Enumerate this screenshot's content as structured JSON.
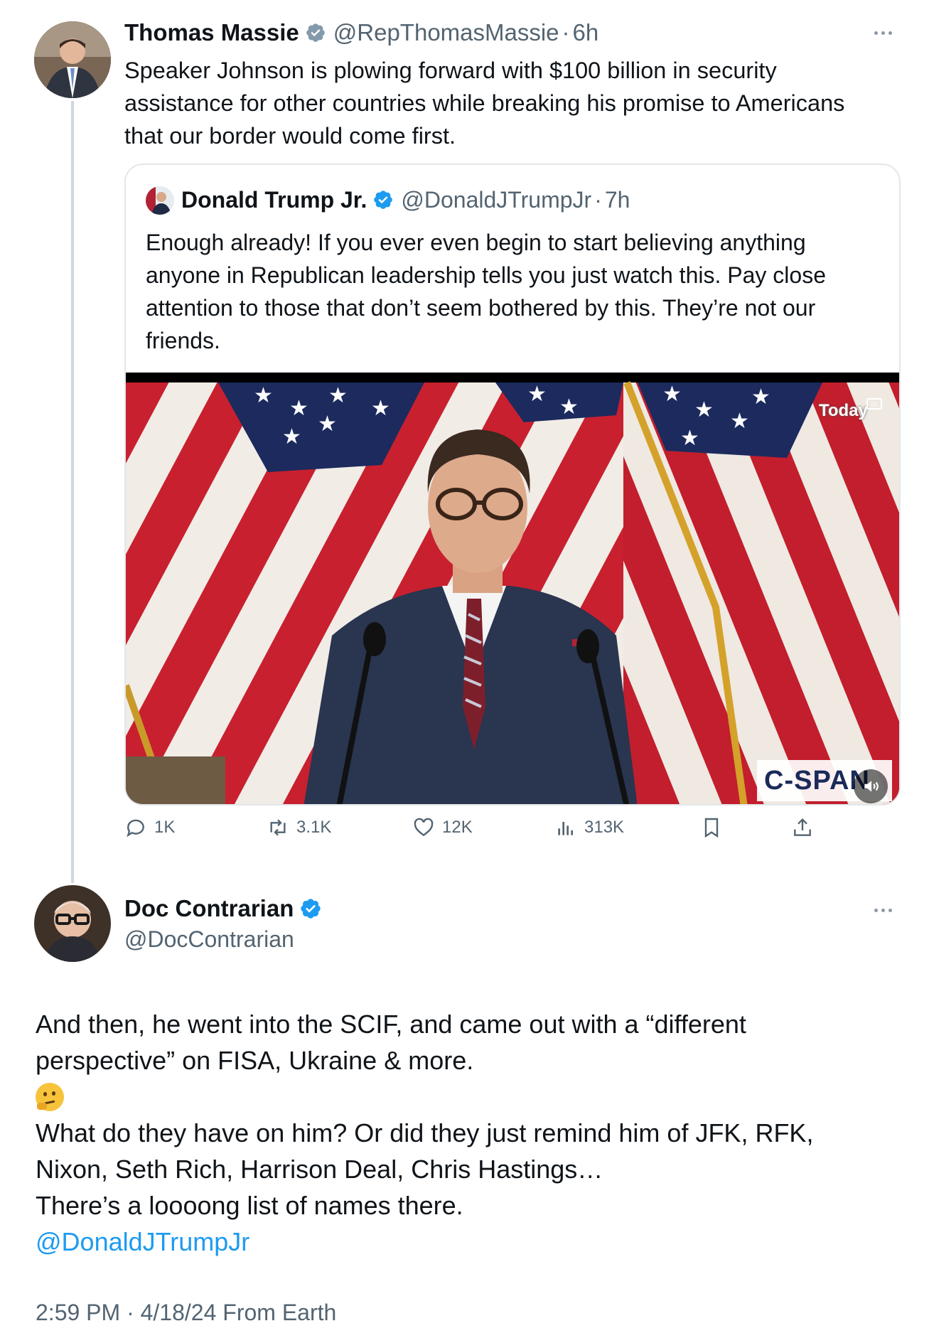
{
  "main_tweet": {
    "author": {
      "name": "Thomas Massie",
      "handle": "@RepThomasMassie",
      "time": "6h"
    },
    "text_lines": [
      "Speaker Johnson is plowing forward with $100 billion in security",
      "assistance for other countries while breaking his promise to Americans",
      "that our border would come first."
    ],
    "quoted": {
      "author": {
        "name": "Donald Trump Jr.",
        "handle": "@DonaldJTrumpJr",
        "time": "7h"
      },
      "text_lines": [
        "Enough already! If you ever even begin to start believing anything",
        "anyone in Republican leadership tells you just watch this. Pay close",
        "attention to those that don’t seem bothered by this. They’re not our",
        "friends."
      ],
      "video": {
        "watermark": "Today",
        "network_logo": "C-SPAN"
      }
    },
    "actions": {
      "replies": "1K",
      "reposts": "3.1K",
      "likes": "12K",
      "views": "313K"
    }
  },
  "reply_tweet": {
    "author": {
      "name": "Doc Contrarian",
      "handle": "@DocContrarian"
    },
    "paragraphs": [
      "And then, he went into the SCIF, and came out with a “different",
      "perspective” on FISA, Ukraine & more.",
      "🤔",
      "What do they have on him? Or did they just remind him of JFK, RFK,",
      "Nixon, Seth Rich, Harrison Deal, Chris Hastings…",
      "There’s a loooong list of names there."
    ],
    "mention": "@DonaldJTrumpJr",
    "timestamp": "2:59 PM · 4/18/24 From Earth"
  },
  "colors": {
    "accent": "#1d9bf0",
    "secondary_text": "#536471",
    "border": "#e3e7ea",
    "verified_blue": "#1d9bf0",
    "verified_gray": "#829aab"
  },
  "icons": [
    "verified-badge-icon",
    "more-icon",
    "reply-icon",
    "repost-icon",
    "like-icon",
    "views-icon",
    "bookmark-icon",
    "share-icon",
    "captions-icon",
    "volume-icon"
  ]
}
